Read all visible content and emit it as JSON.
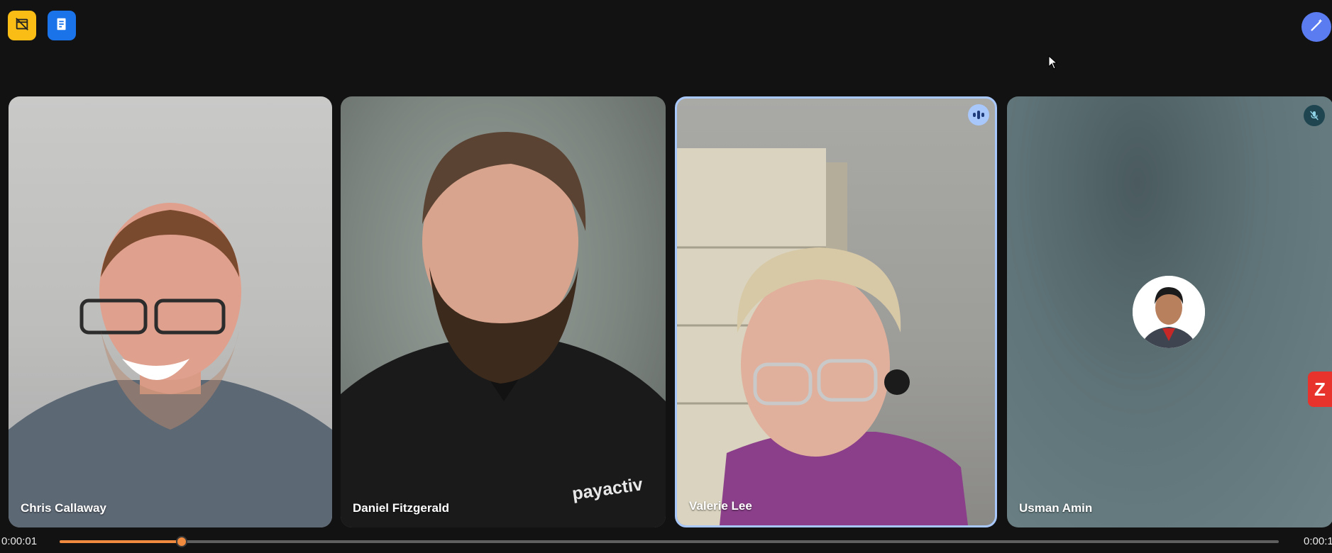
{
  "toolbar": {
    "left_buttons": [
      {
        "icon": "film-off-icon",
        "color": "#f9bd15"
      },
      {
        "icon": "doc-edit-icon",
        "color": "#1a73e8"
      }
    ],
    "right_button": {
      "icon": "magic-wand-icon",
      "color": "#5b7cf0"
    }
  },
  "participants": [
    {
      "name": "Chris Callaway",
      "state": "video"
    },
    {
      "name": "Daniel Fitzgerald",
      "state": "video",
      "shirt_text": "payactiv"
    },
    {
      "name": "Valerie Lee",
      "state": "speaking",
      "highlight_color": "#a8c7fa"
    },
    {
      "name": "Usman Amin",
      "state": "muted"
    }
  ],
  "side_tab": {
    "label": "Z"
  },
  "player": {
    "current_time": "0:00:01",
    "total_time": "0:00:1",
    "progress": 0.1
  }
}
